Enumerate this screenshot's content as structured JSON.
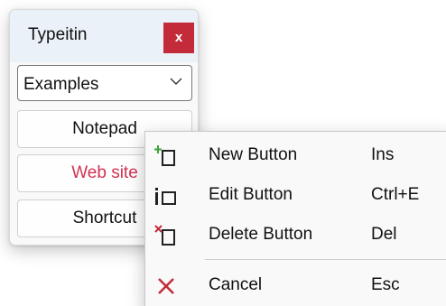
{
  "window": {
    "title": "Typeitin",
    "close_label": "x",
    "dropdown": {
      "selected": "Examples"
    },
    "buttons": [
      {
        "label": "Notepad"
      },
      {
        "label": "Web site"
      },
      {
        "label": "Shortcut"
      }
    ]
  },
  "context_menu": {
    "items": [
      {
        "label": "New Button",
        "shortcut": "Ins",
        "icon": "new-button-icon"
      },
      {
        "label": "Edit Button",
        "shortcut": "Ctrl+E",
        "icon": "edit-button-icon"
      },
      {
        "label": "Delete Button",
        "shortcut": "Del",
        "icon": "delete-button-icon"
      },
      {
        "label": "Cancel",
        "shortcut": "Esc",
        "icon": "cancel-icon"
      }
    ]
  },
  "colors": {
    "close_bg": "#c42b3a",
    "highlight_text": "#d13352",
    "new_icon_accent": "#3aa63a",
    "delete_icon_accent": "#c42b3a",
    "cancel_icon": "#c42b3a"
  }
}
